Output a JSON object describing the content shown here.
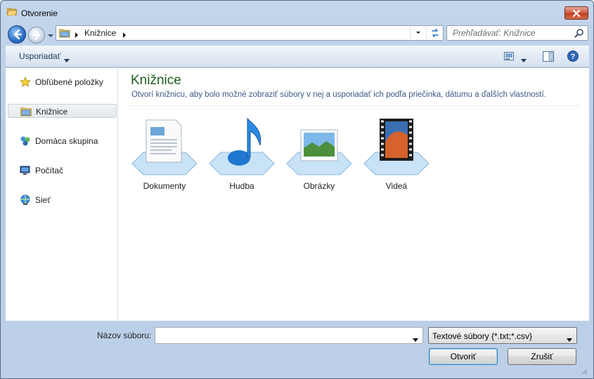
{
  "window": {
    "title": "Otvorenie"
  },
  "address": {
    "crumb": "Knižnice"
  },
  "search": {
    "placeholder": "Prehľadávať: Knižnice"
  },
  "toolbar": {
    "organize_label": "Usporiadať"
  },
  "sidebar": {
    "items": [
      {
        "label": "Obľúbené položky",
        "icon": "star-icon"
      },
      {
        "label": "Knižnice",
        "icon": "libraries-icon",
        "selected": true
      },
      {
        "label": "Domáca skupina",
        "icon": "homegroup-icon"
      },
      {
        "label": "Počítač",
        "icon": "computer-icon"
      },
      {
        "label": "Sieť",
        "icon": "network-icon"
      }
    ]
  },
  "main": {
    "title": "Knižnice",
    "description": "Otvorí knižnicu, aby bolo možné zobraziť súbory v nej a usporiadať ich podľa priečinka, dátumu a ďalších vlastností.",
    "libraries": [
      {
        "label": "Dokumenty",
        "icon": "documents-library-icon"
      },
      {
        "label": "Hudba",
        "icon": "music-library-icon"
      },
      {
        "label": "Obrázky",
        "icon": "pictures-library-icon"
      },
      {
        "label": "Videá",
        "icon": "videos-library-icon"
      }
    ]
  },
  "bottom": {
    "filename_label": "Názov súboru:",
    "filename_value": "",
    "filetype_value": "Textové súbory {*.txt;*.csv}",
    "open_label": "Otvoriť",
    "cancel_label": "Zrušiť"
  },
  "colors": {
    "accent_title": "#1e5d1e",
    "description": "#3c5a88",
    "close": "#c0401f"
  }
}
